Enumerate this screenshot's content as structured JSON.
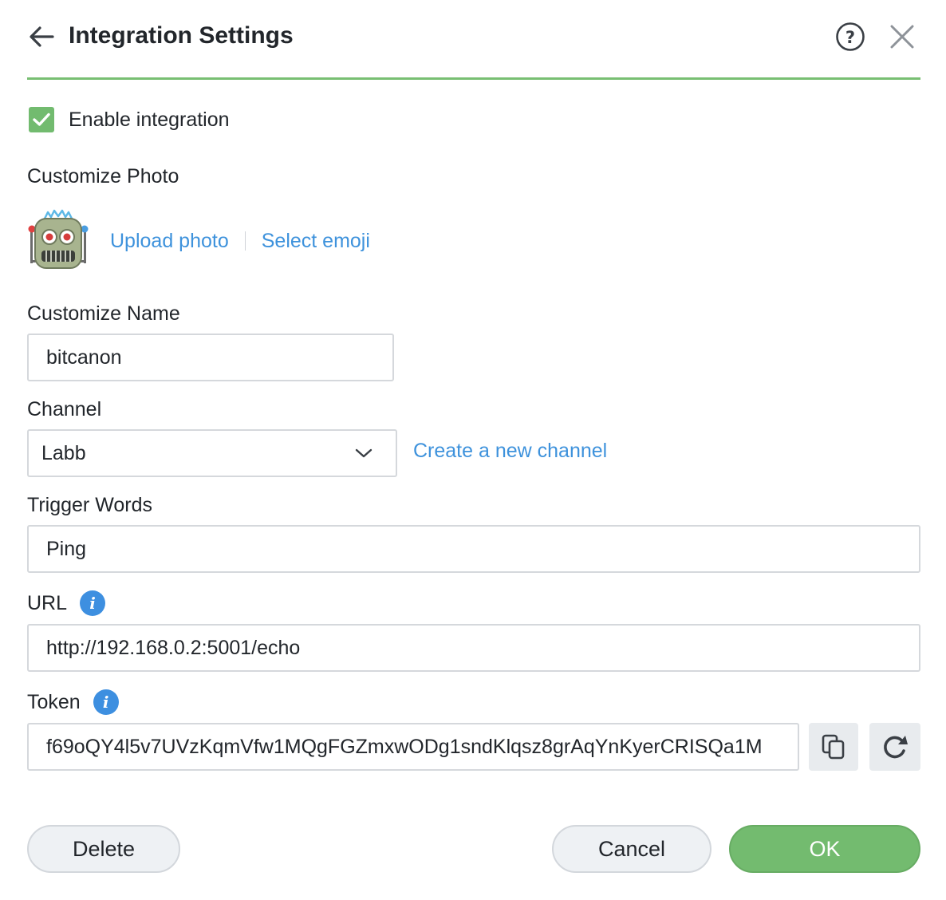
{
  "header": {
    "title": "Integration Settings",
    "back_icon": "arrow-left-icon",
    "help_icon": "question-circle-icon",
    "close_icon": "close-icon"
  },
  "enable": {
    "label": "Enable integration",
    "checked": true
  },
  "photo": {
    "label": "Customize Photo",
    "avatar_icon": "robot-emoji",
    "upload_label": "Upload photo",
    "emoji_label": "Select emoji"
  },
  "name": {
    "label": "Customize Name",
    "value": "bitcanon"
  },
  "channel": {
    "label": "Channel",
    "value": "Labb",
    "create_link": "Create a new channel"
  },
  "trigger": {
    "label": "Trigger Words",
    "value": "Ping"
  },
  "url": {
    "label": "URL",
    "value": "http://192.168.0.2:5001/echo",
    "info_icon": "info-icon"
  },
  "token": {
    "label": "Token",
    "value": "f69oQY4l5v7UVzKqmVfw1MQgFGZmxwODg1sndKlqsz8grAqYnKyerCRISQa1M",
    "info_icon": "info-icon",
    "copy_icon": "copy-icon",
    "refresh_icon": "refresh-icon"
  },
  "buttons": {
    "delete": "Delete",
    "cancel": "Cancel",
    "ok": "OK"
  },
  "colors": {
    "accent_green": "#73bb6f",
    "link_blue": "#3e92dc",
    "info_blue": "#3d8fe0"
  }
}
